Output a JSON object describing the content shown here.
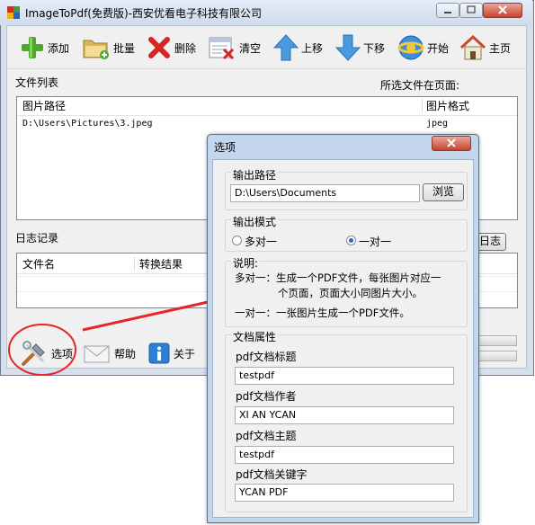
{
  "main": {
    "title": "ImageToPdf(免费版)-西安优看电子科技有限公司",
    "toolbar": [
      {
        "label": "添加",
        "icon": "add-icon"
      },
      {
        "label": "批量",
        "icon": "batch-folder-icon"
      },
      {
        "label": "删除",
        "icon": "delete-icon"
      },
      {
        "label": "清空",
        "icon": "clear-icon"
      },
      {
        "label": "上移",
        "icon": "arrow-up-icon"
      },
      {
        "label": "下移",
        "icon": "arrow-down-icon"
      },
      {
        "label": "开始",
        "icon": "start-icon"
      },
      {
        "label": "主页",
        "icon": "home-icon"
      }
    ],
    "file_list_label": "文件列表",
    "selected_page_label": "所选文件在页面:",
    "file_table": {
      "columns": [
        "图片路径",
        "图片格式"
      ],
      "rows": [
        {
          "path": "D:\\Users\\Pictures\\3.jpeg",
          "format": "jpeg"
        }
      ]
    },
    "log_label": "日志记录",
    "log_button_label": "日志",
    "log_table": {
      "columns": [
        "文件名",
        "转换结果"
      ]
    },
    "bottom_buttons": [
      {
        "label": "选项",
        "icon": "options-tools-icon"
      },
      {
        "label": "帮助",
        "icon": "help-mail-icon"
      },
      {
        "label": "关于",
        "icon": "about-info-icon"
      }
    ]
  },
  "dialog": {
    "title": "选项",
    "output_path": {
      "group_label": "输出路径",
      "value": "D:\\Users\\Documents",
      "browse_label": "浏览"
    },
    "output_mode": {
      "group_label": "输出模式",
      "options": [
        {
          "label": "多对一",
          "selected": false
        },
        {
          "label": "一对一",
          "selected": true
        }
      ]
    },
    "description": {
      "group_label": "说明:",
      "line1": "多对一：生成一个PDF文件，每张图片对应一",
      "line2": "个页面，页面大小同图片大小。",
      "line3": "一对一：一张图片生成一个PDF文件。"
    },
    "doc_props": {
      "group_label": "文档属性",
      "title_label": "pdf文档标题",
      "title_value": "testpdf",
      "author_label": "pdf文档作者",
      "author_value": "XI AN YCAN",
      "subject_label": "pdf文档主题",
      "subject_value": "testpdf",
      "keywords_label": "pdf文档关键字",
      "keywords_value": "YCAN PDF"
    }
  },
  "colors": {
    "annotation_red": "#e8262a",
    "title_bg": "#d5e1f0"
  }
}
